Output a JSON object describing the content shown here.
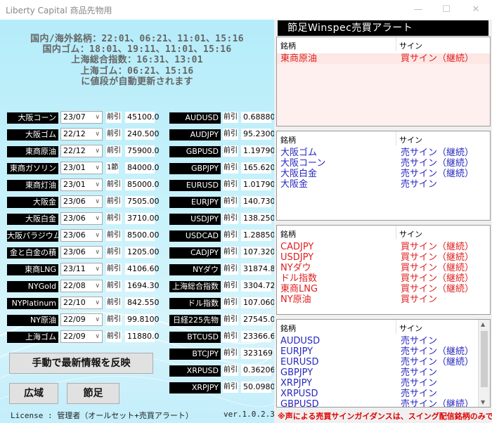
{
  "window": {
    "title": "Liberty Capital 商品先物用",
    "minimize": "—",
    "maximize": "☐",
    "close": "✕"
  },
  "info_lines": [
    "国内/海外銘柄：22:01、06:21、11:01、15:16",
    "国内ゴム：18:01、19:11、11:01、15:16",
    "上海総合指数：16:31、13:01",
    "上海ゴム：06:21、15:16",
    "に値段が自動更新されます"
  ],
  "commodities": [
    {
      "name": "大阪コーン",
      "month": "23/07",
      "tag": "前引",
      "price": "45100.0"
    },
    {
      "name": "大阪ゴム",
      "month": "22/12",
      "tag": "前引",
      "price": "240.500"
    },
    {
      "name": "東商原油",
      "month": "22/12",
      "tag": "前引",
      "price": "75900.0"
    },
    {
      "name": "東商ガソリン",
      "month": "23/01",
      "tag": "1節",
      "price": "84000.0"
    },
    {
      "name": "東商灯油",
      "month": "23/01",
      "tag": "前引",
      "price": "85000.0"
    },
    {
      "name": "大阪金",
      "month": "23/06",
      "tag": "前引",
      "price": "7505.00"
    },
    {
      "name": "大阪白金",
      "month": "23/06",
      "tag": "前引",
      "price": "3710.00"
    },
    {
      "name": "大阪パラジウム",
      "month": "23/06",
      "tag": "前引",
      "price": "8500.00"
    },
    {
      "name": "金と白金の積",
      "month": "23/06",
      "tag": "前引",
      "price": "1205.00"
    },
    {
      "name": "東商LNG",
      "month": "23/11",
      "tag": "前引",
      "price": "4106.60"
    },
    {
      "name": "NYGold",
      "month": "22/08",
      "tag": "前引",
      "price": "1694.30"
    },
    {
      "name": "NYPlatinum",
      "month": "22/10",
      "tag": "前引",
      "price": "842.550"
    },
    {
      "name": "NY原油",
      "month": "22/09",
      "tag": "前引",
      "price": "99.8100"
    },
    {
      "name": "上海ゴム",
      "month": "22/09",
      "tag": "前引",
      "price": "11880.0"
    }
  ],
  "fx": [
    {
      "name": "AUDUSD",
      "tag": "前引",
      "price": "0.68880"
    },
    {
      "name": "AUDJPY",
      "tag": "前引",
      "price": "95.2300"
    },
    {
      "name": "GBPUSD",
      "tag": "前引",
      "price": "1.19790"
    },
    {
      "name": "GBPJPY",
      "tag": "前引",
      "price": "165.620"
    },
    {
      "name": "EURUSD",
      "tag": "前引",
      "price": "1.01790"
    },
    {
      "name": "EURJPY",
      "tag": "前引",
      "price": "140.730"
    },
    {
      "name": "USDJPY",
      "tag": "前引",
      "price": "138.250"
    },
    {
      "name": "USDCAD",
      "tag": "前引",
      "price": "1.28850"
    },
    {
      "name": "CADJPY",
      "tag": "前引",
      "price": "107.320"
    },
    {
      "name": "NYダウ",
      "tag": "前引",
      "price": "31874.8"
    },
    {
      "name": "上海総合指数",
      "tag": "前引",
      "price": "3304.72"
    },
    {
      "name": "ドル指数",
      "tag": "前引",
      "price": "107.060"
    },
    {
      "name": "日経225先物",
      "tag": "前引",
      "price": "27545.0"
    },
    {
      "name": "BTCUSD",
      "tag": "前引",
      "price": "23366.6"
    },
    {
      "name": "BTCJPY",
      "tag": "前引",
      "price": "323169"
    },
    {
      "name": "XRPUSD",
      "tag": "前引",
      "price": "0.36206"
    },
    {
      "name": "XRPJPY",
      "tag": "前引",
      "price": "50.0980"
    }
  ],
  "buttons": {
    "refresh": "手動で最新情報を反映",
    "wide": "広域",
    "setsu": "節足"
  },
  "footer": {
    "license": "License : 管理者（オールセット+売買アラート）",
    "version": "ver.1.0.2.3"
  },
  "alert": {
    "header": "節足Winspec売買アラート",
    "col_name": "銘柄",
    "col_sign": "サイン",
    "panels": [
      {
        "rows": [
          {
            "name": "東商原油",
            "sign": "買サイン（継続）",
            "color": "red"
          }
        ]
      },
      {
        "rows": [
          {
            "name": "大阪ゴム",
            "sign": "売サイン（継続）",
            "color": "blue"
          },
          {
            "name": "大阪コーン",
            "sign": "売サイン（継続）",
            "color": "blue"
          },
          {
            "name": "大阪白金",
            "sign": "売サイン（継続）",
            "color": "blue"
          },
          {
            "name": "大阪金",
            "sign": "売サイン",
            "color": "blue"
          }
        ]
      },
      {
        "rows": [
          {
            "name": "CADJPY",
            "sign": "買サイン（継続）",
            "color": "red"
          },
          {
            "name": "USDJPY",
            "sign": "買サイン（継続）",
            "color": "red"
          },
          {
            "name": "NYダウ",
            "sign": "買サイン（継続）",
            "color": "red"
          },
          {
            "name": "ドル指数",
            "sign": "買サイン（継続）",
            "color": "red"
          },
          {
            "name": "東商LNG",
            "sign": "買サイン（継続）",
            "color": "red"
          },
          {
            "name": "NY原油",
            "sign": "買サイン",
            "color": "red"
          }
        ]
      },
      {
        "rows": [
          {
            "name": "AUDUSD",
            "sign": "売サイン",
            "color": "blue"
          },
          {
            "name": "EURJPY",
            "sign": "売サイン（継続）",
            "color": "blue"
          },
          {
            "name": "EURUSD",
            "sign": "売サイン（継続）",
            "color": "blue"
          },
          {
            "name": "GBPJPY",
            "sign": "売サイン",
            "color": "blue"
          },
          {
            "name": "XRPJPY",
            "sign": "売サイン",
            "color": "blue"
          },
          {
            "name": "XRPUSD",
            "sign": "売サイン",
            "color": "blue"
          },
          {
            "name": "GBPUSD",
            "sign": "売サイン（継続）",
            "color": "blue"
          }
        ]
      }
    ],
    "warning": "※声による売買サインガイダンスは、スイング配信銘柄のみです"
  }
}
